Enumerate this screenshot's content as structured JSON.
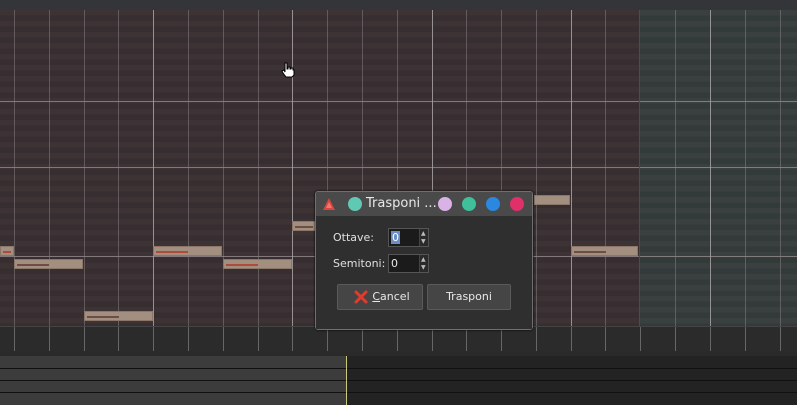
{
  "window": {
    "dialog": {
      "title": "Trasponi ...",
      "fields": {
        "octaves": {
          "label": "Ottave:",
          "value": "0"
        },
        "semitones": {
          "label": "Semitoni:",
          "value": "0"
        }
      },
      "buttons": {
        "cancel": {
          "label": "Cancel",
          "mnemonic": "C",
          "icon": "cancel-x-icon"
        },
        "transpose": {
          "label": "Trasponi"
        }
      },
      "titlebar_buttons": [
        {
          "name": "sticky-button",
          "color": "#5fc9b3"
        },
        {
          "name": "shade-button",
          "color": "#d9b3e6"
        },
        {
          "name": "minimize-button",
          "color": "#3fbf9a"
        },
        {
          "name": "maximize-button",
          "color": "#2b88e0"
        },
        {
          "name": "close-button",
          "color": "#e0306a"
        }
      ]
    }
  },
  "colors": {
    "note_fill": "#a38f7f",
    "note_velocity": "#6e4e44",
    "note_velocity_selected": "#b04a3a",
    "playhead": "#c9c97a"
  }
}
